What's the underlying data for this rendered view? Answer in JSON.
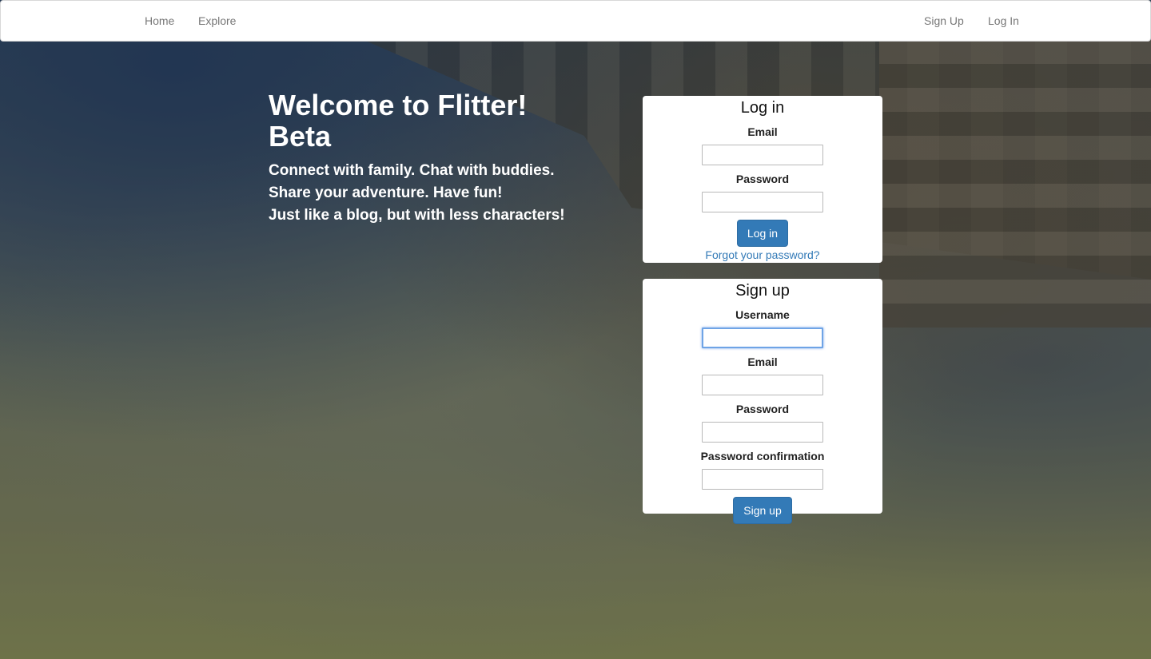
{
  "nav": {
    "home": "Home",
    "explore": "Explore",
    "signup": "Sign Up",
    "login": "Log In"
  },
  "hero": {
    "title_line1": "Welcome to Flitter!",
    "title_line2": "Beta",
    "tagline_line1": "Connect with family. Chat with buddies.",
    "tagline_line2": "Share your adventure. Have fun!",
    "tagline_line3": "Just like a blog, but with less characters!"
  },
  "login": {
    "title": "Log in",
    "email_label": "Email",
    "email_value": "",
    "password_label": "Password",
    "password_value": "",
    "submit": "Log in",
    "forgot": "Forgot your password?"
  },
  "signup": {
    "title": "Sign up",
    "username_label": "Username",
    "username_value": "",
    "email_label": "Email",
    "email_value": "",
    "password_label": "Password",
    "password_value": "",
    "confirm_label": "Password confirmation",
    "confirm_value": "",
    "submit": "Sign up"
  },
  "colors": {
    "primary": "#337ab7",
    "nav_text": "#777777",
    "focus_ring": "#6fa4e6"
  }
}
